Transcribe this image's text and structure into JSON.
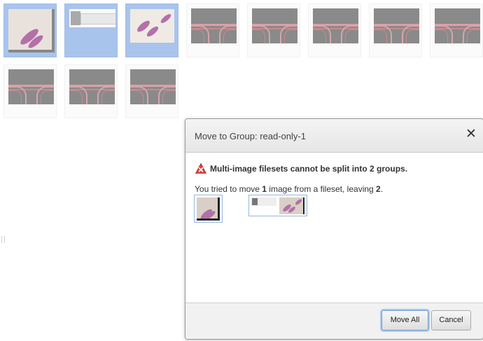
{
  "thumbnails": [
    {
      "kind": "slide-large",
      "selected": true
    },
    {
      "kind": "label-strip",
      "selected": true
    },
    {
      "kind": "slide-small",
      "selected": true
    },
    {
      "kind": "histology",
      "selected": false
    },
    {
      "kind": "histology",
      "selected": false
    },
    {
      "kind": "histology",
      "selected": false
    },
    {
      "kind": "histology",
      "selected": false
    },
    {
      "kind": "histology",
      "selected": false
    },
    {
      "kind": "histology",
      "selected": false
    },
    {
      "kind": "histology",
      "selected": false
    },
    {
      "kind": "histology",
      "selected": false
    }
  ],
  "dialog": {
    "title": "Move to Group: read-only-1",
    "close_icon": "close-icon",
    "error_icon": "error-icon",
    "error_message": "Multi-image filesets cannot be split into 2 groups.",
    "info_prefix": "You tried to move ",
    "info_count_moved": "1",
    "info_middle": " image from a fileset, leaving ",
    "info_count_left": "2",
    "info_suffix": ".",
    "buttons": {
      "move_all": "Move All",
      "cancel": "Cancel"
    }
  },
  "colors": {
    "selection": "#a9c4ec",
    "error_red": "#d9413b",
    "focus_ring": "#a9c9ef"
  }
}
